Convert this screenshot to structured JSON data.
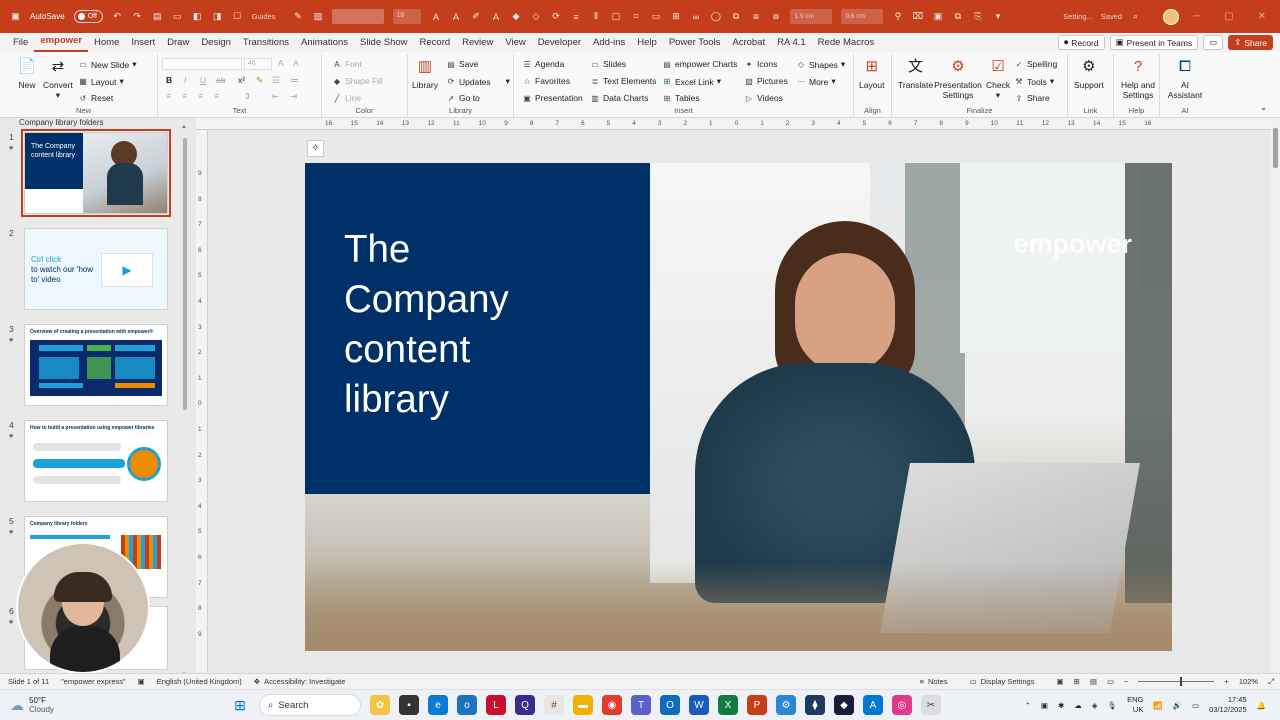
{
  "titlebar": {
    "autosave_label": "AutoSave",
    "autosave_state": "Off",
    "status": "Setting...",
    "saved": "Saved",
    "font_size_box": "18",
    "measure1": "1.9 cm",
    "measure2": "9.6 cm",
    "guides_label": "Guides"
  },
  "menu": {
    "tabs": [
      "File",
      "empower",
      "Home",
      "Insert",
      "Draw",
      "Design",
      "Transitions",
      "Animations",
      "Slide Show",
      "Record",
      "Review",
      "View",
      "Developer",
      "Add-ins",
      "Help",
      "Power Tools",
      "Acrobat",
      "RA 4.1",
      "Rede Macros"
    ],
    "active_tab": "empower",
    "record": "Record",
    "present": "Present in Teams",
    "share": "Share"
  },
  "ribbon": {
    "new_group": {
      "label": "New",
      "new": "New",
      "convert": "Convert",
      "new_slide": "New Slide",
      "layout": "Layout",
      "reset": "Reset"
    },
    "text_group": {
      "label": "Text",
      "font": "",
      "size": "46"
    },
    "color_group": {
      "label": "Color",
      "font": "Font",
      "shape_fill": "Shape Fill",
      "line": "Line"
    },
    "library_group": {
      "label": "Library",
      "library": "Library",
      "save": "Save",
      "updates": "Updates",
      "go_to": "Go to"
    },
    "insert_group": {
      "label": "Insert",
      "agenda": "Agenda",
      "favorites": "Favorites",
      "presentation": "Presentation",
      "slides": "Slides",
      "text_elements": "Text Elements",
      "data_charts": "Data Charts",
      "empower_charts": "empower Charts",
      "excel_link": "Excel Link",
      "tables": "Tables",
      "icons": "Icons",
      "pictures": "Pictures",
      "videos": "Videos",
      "shapes": "Shapes",
      "more": "More"
    },
    "align_group": {
      "label": "Align",
      "layout": "Layout"
    },
    "finalize_group": {
      "label": "Finalize",
      "translate": "Translate",
      "presentation_settings": "Presentation Settings",
      "check": "Check",
      "spelling": "Spelling",
      "tools": "Tools",
      "share": "Share"
    },
    "link_group": {
      "label": "Link",
      "support": "Support"
    },
    "help_group": {
      "label": "Help",
      "help_settings": "Help and Settings"
    },
    "ai_group": {
      "label": "AI",
      "ai_assistant": "AI Assistant"
    }
  },
  "rulers": {
    "horizontal": [
      "16",
      "15",
      "14",
      "13",
      "12",
      "11",
      "10",
      "9",
      "8",
      "7",
      "6",
      "5",
      "4",
      "3",
      "2",
      "1",
      "0",
      "1",
      "2",
      "3",
      "4",
      "5",
      "6",
      "7",
      "8",
      "9",
      "10",
      "11",
      "12",
      "13",
      "14",
      "15",
      "16"
    ],
    "vertical": [
      "9",
      "8",
      "7",
      "6",
      "5",
      "4",
      "3",
      "2",
      "1",
      "0",
      "1",
      "2",
      "3",
      "4",
      "5",
      "6",
      "7",
      "8",
      "9"
    ]
  },
  "thumbnails": {
    "header": "Company library folders",
    "items": [
      {
        "num": "1",
        "title": "The Company content library"
      },
      {
        "num": "2",
        "title": "Ctrl click",
        "subtitle": "to watch our 'how to' video"
      },
      {
        "num": "3",
        "title": "Overview of creating a presentation with empower®"
      },
      {
        "num": "4",
        "title": "How to build a presentation using empower libraries"
      },
      {
        "num": "5",
        "title": "Company library folders"
      },
      {
        "num": "6",
        "title": ""
      }
    ]
  },
  "slide": {
    "title": "The\nCompany\ncontent\nlibrary",
    "brand": "empower"
  },
  "statusbar": {
    "slide_info": "Slide 1 of 11",
    "theme": "\"empower express\"",
    "language": "English (United Kingdom)",
    "accessibility": "Accessibility: Investigate",
    "notes": "Notes",
    "display_settings": "Display Settings",
    "zoom": "102%"
  },
  "taskbar": {
    "temp": "50°F",
    "weather": "Cloudy",
    "search": "Search",
    "lang": "ENG",
    "region": "UK",
    "time": "17:45",
    "date": "03/12/2025"
  },
  "colors": {
    "accent": "#c43e1c",
    "slide_blue": "#003068"
  }
}
